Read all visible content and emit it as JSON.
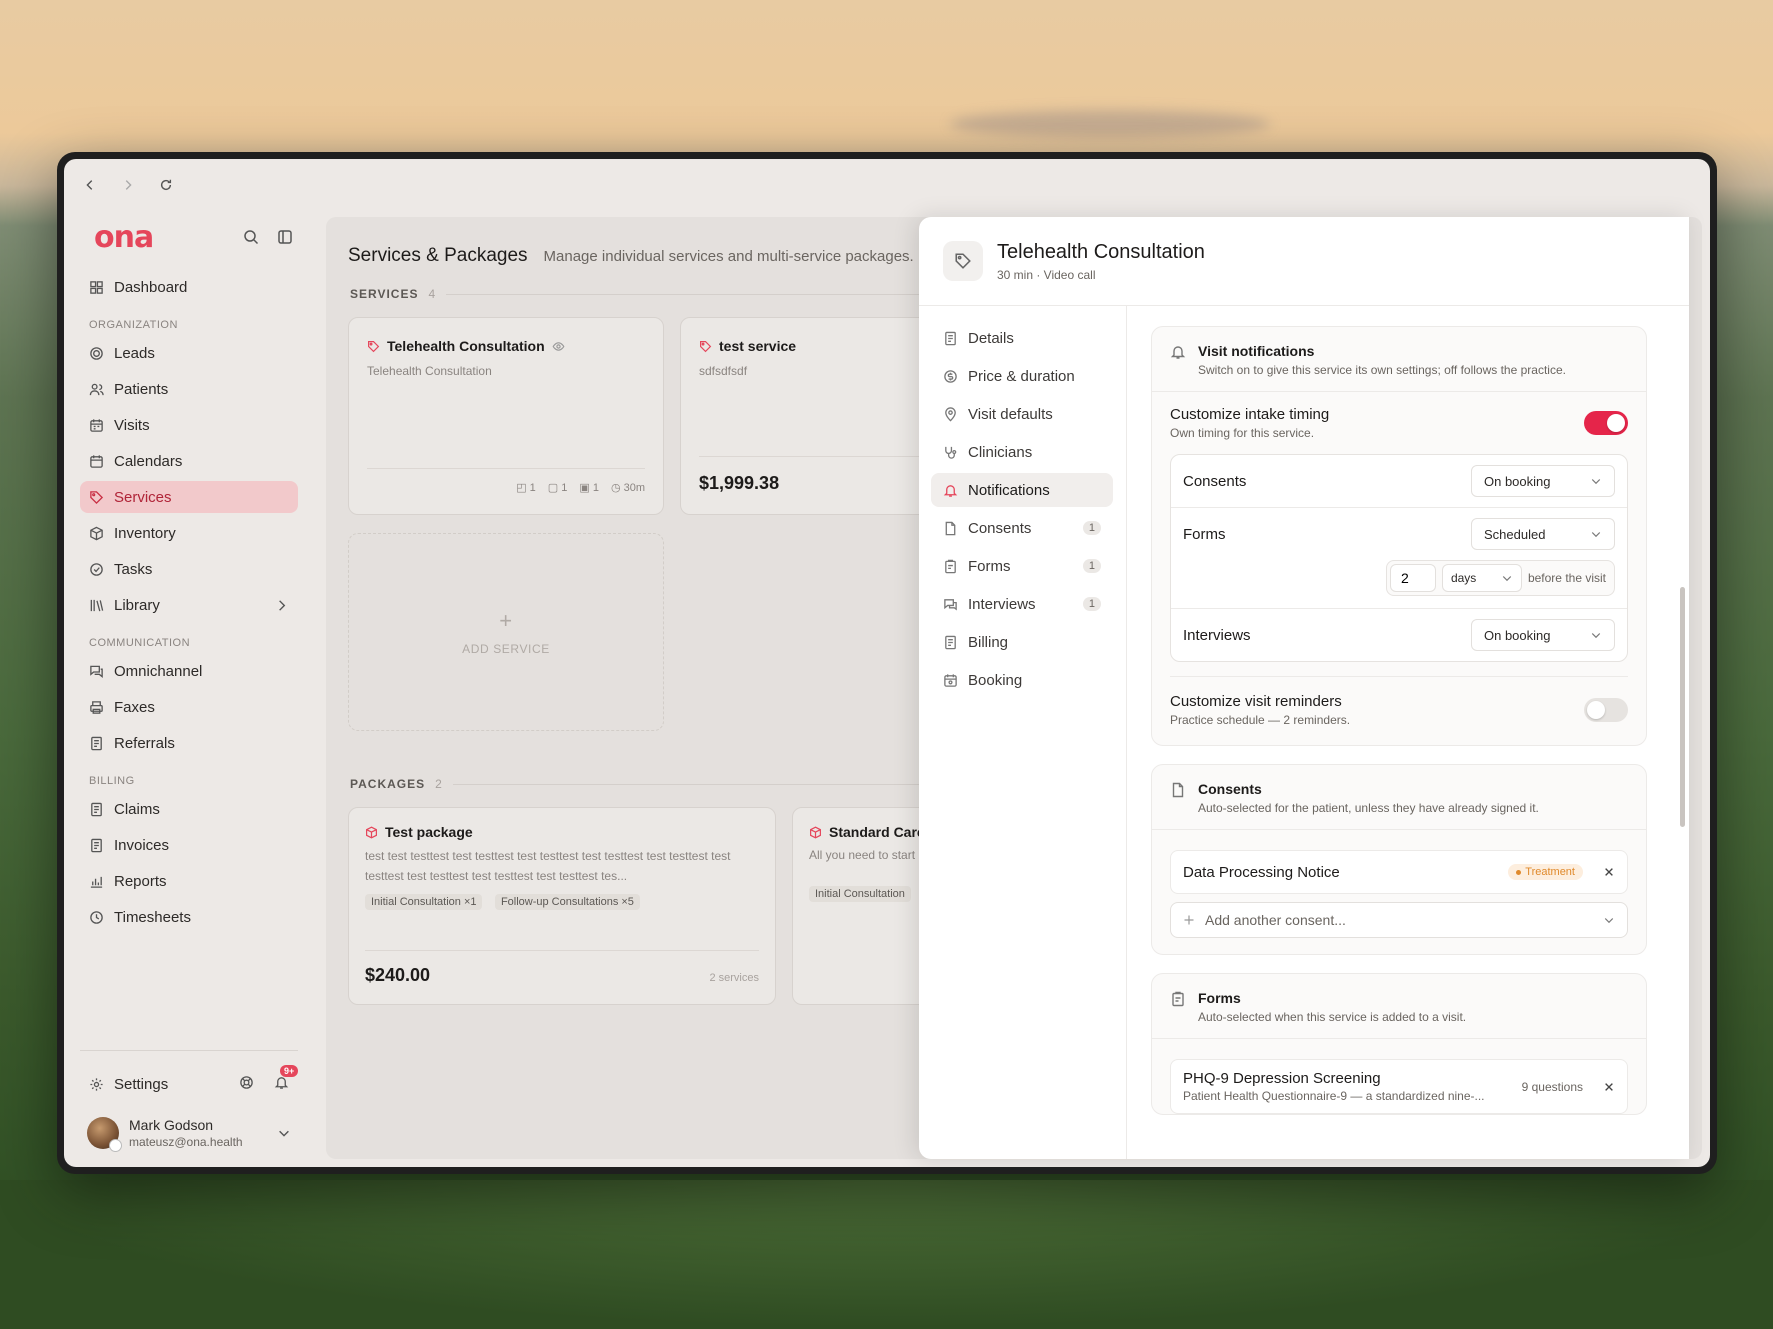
{
  "browser": {},
  "brand": {
    "logo": "ona",
    "accent": "#e5465b"
  },
  "sidebar": {
    "dashboard": "Dashboard",
    "sections": {
      "organization": "ORGANIZATION",
      "communication": "COMMUNICATION",
      "billing": "BILLING"
    },
    "org_items": [
      {
        "label": "Leads",
        "icon": "target-icon"
      },
      {
        "label": "Patients",
        "icon": "users-icon"
      },
      {
        "label": "Visits",
        "icon": "calendar-list-icon"
      },
      {
        "label": "Calendars",
        "icon": "calendar-icon"
      },
      {
        "label": "Services",
        "icon": "tag-icon"
      },
      {
        "label": "Inventory",
        "icon": "box-icon"
      },
      {
        "label": "Tasks",
        "icon": "check-circle-icon"
      },
      {
        "label": "Library",
        "icon": "library-icon"
      }
    ],
    "comm_items": [
      {
        "label": "Omnichannel",
        "icon": "chat-icon"
      },
      {
        "label": "Faxes",
        "icon": "printer-icon"
      },
      {
        "label": "Referrals",
        "icon": "document-icon"
      }
    ],
    "billing_items": [
      {
        "label": "Claims",
        "icon": "document-icon"
      },
      {
        "label": "Invoices",
        "icon": "document-icon"
      },
      {
        "label": "Reports",
        "icon": "chart-icon"
      },
      {
        "label": "Timesheets",
        "icon": "clock-icon"
      }
    ],
    "settings": "Settings",
    "notif_badge": "9+",
    "user": {
      "name": "Mark Godson",
      "email": "mateusz@ona.health"
    }
  },
  "main": {
    "title": "Services & Packages",
    "subtitle": "Manage individual services and multi-service packages.",
    "services_label": "SERVICES",
    "services_count": "4",
    "services": [
      {
        "title": "Telehealth Consultation",
        "desc": "Telehealth Consultation",
        "meta": [
          "1",
          "1",
          "1",
          "30m"
        ]
      },
      {
        "title": "test service",
        "desc": "sdfsdfsdf",
        "price": "$1,999.38"
      }
    ],
    "add_service": "ADD SERVICE",
    "packages_label": "PACKAGES",
    "packages_count": "2",
    "packages": [
      {
        "title": "Test package",
        "desc": "test test testtest test testtest test testtest test testtest test testtest test testtest test testtest test testtest test testtest tes...",
        "tags": [
          "Initial Consultation ×1",
          "Follow-up Consultations ×5"
        ],
        "price": "$240.00",
        "services": "2 services"
      },
      {
        "title": "Standard Care",
        "desc": "All you need to start",
        "tags": [
          "Initial Consultation"
        ]
      }
    ]
  },
  "drawer": {
    "title": "Telehealth Consultation",
    "subtitle": "30 min · Video call",
    "nav": [
      {
        "label": "Details",
        "icon": "document-icon",
        "count": ""
      },
      {
        "label": "Price & duration",
        "icon": "dollar-icon",
        "count": ""
      },
      {
        "label": "Visit defaults",
        "icon": "pin-icon",
        "count": ""
      },
      {
        "label": "Clinicians",
        "icon": "stethoscope-icon",
        "count": ""
      },
      {
        "label": "Notifications",
        "icon": "bell-icon",
        "count": "",
        "active": true
      },
      {
        "label": "Consents",
        "icon": "document-icon",
        "count": "1"
      },
      {
        "label": "Forms",
        "icon": "clipboard-icon",
        "count": "1"
      },
      {
        "label": "Interviews",
        "icon": "interview-icon",
        "count": "1"
      },
      {
        "label": "Billing",
        "icon": "receipt-icon",
        "count": ""
      },
      {
        "label": "Booking",
        "icon": "calendar-icon",
        "count": ""
      }
    ],
    "visit_notifications": {
      "title": "Visit notifications",
      "desc": "Switch on to give this service its own settings; off follows the practice.",
      "intake": {
        "title": "Customize intake timing",
        "sub": "Own timing for this service.",
        "enabled": true
      },
      "rows": {
        "consents": {
          "label": "Consents",
          "value": "On booking"
        },
        "forms": {
          "label": "Forms",
          "value": "Scheduled",
          "amount": "2",
          "unit": "days",
          "suffix": "before the visit"
        },
        "interviews": {
          "label": "Interviews",
          "value": "On booking"
        }
      },
      "reminders": {
        "title": "Customize visit reminders",
        "sub": "Practice schedule — 2 reminders.",
        "enabled": false
      }
    },
    "consents": {
      "title": "Consents",
      "desc": "Auto-selected for the patient, unless they have already signed it.",
      "item": "Data Processing Notice",
      "badge": "Treatment",
      "add_placeholder": "Add another consent..."
    },
    "forms": {
      "title": "Forms",
      "desc": "Auto-selected when this service is added to a visit.",
      "item_title": "PHQ-9 Depression Screening",
      "item_sub": "Patient Health Questionnaire-9 — a standardized nine-...",
      "questions": "9 questions"
    }
  }
}
